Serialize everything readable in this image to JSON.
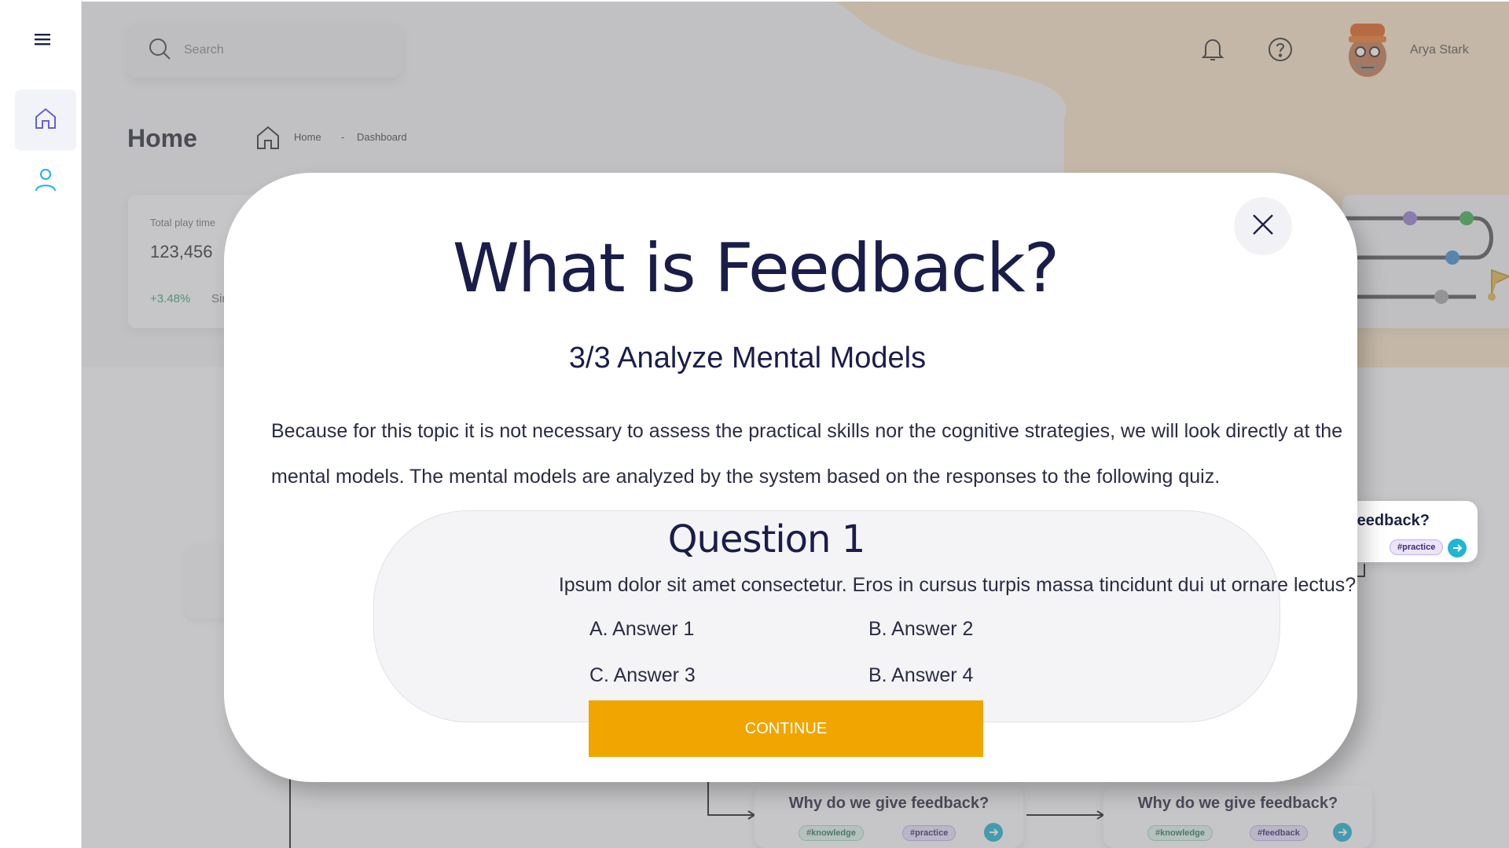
{
  "header": {
    "search_placeholder": "Search",
    "user_name": "Arya Stark"
  },
  "page": {
    "title": "Home",
    "breadcrumb": [
      "Home",
      "-",
      "Dashboard"
    ]
  },
  "sidebar": {
    "items": [
      {
        "icon": "home-icon",
        "active": true
      },
      {
        "icon": "user-icon",
        "active": false
      }
    ]
  },
  "stat_card": {
    "label": "Total play time",
    "value": "123,456",
    "change": "+3.48%",
    "since": "Since"
  },
  "nodes": [
    {
      "title": "Why do we give feedback?",
      "tags": [
        "#knowledge",
        "#practice"
      ]
    },
    {
      "title": "Why do we give feedback?",
      "tags": [
        "#knowledge",
        "#feedback"
      ]
    },
    {
      "title": "feedback?",
      "tags": [
        "#practice"
      ]
    }
  ],
  "modal": {
    "title": "What is Feedback?",
    "subtitle": "3/3 Analyze Mental Models",
    "description": "Because for this topic it is not necessary to assess the practical skills nor the cognitive strategies, we will look directly at the mental models. The mental models are analyzed by the system based on the responses to the following quiz.",
    "question": {
      "title": "Question 1",
      "text": "Ipsum dolor sit amet consectetur. Eros in cursus turpis massa tincidunt dui ut ornare lectus?",
      "answers": [
        "A. Answer 1",
        "B. Answer 2",
        "C. Answer 3",
        "B. Answer 4"
      ]
    },
    "continue_label": "CONTINUE"
  },
  "colors": {
    "accent": "#f0a500",
    "title": "#1a1d4a",
    "teal": "#1fb6d3",
    "sidebar_active": "#6b5fd1"
  }
}
